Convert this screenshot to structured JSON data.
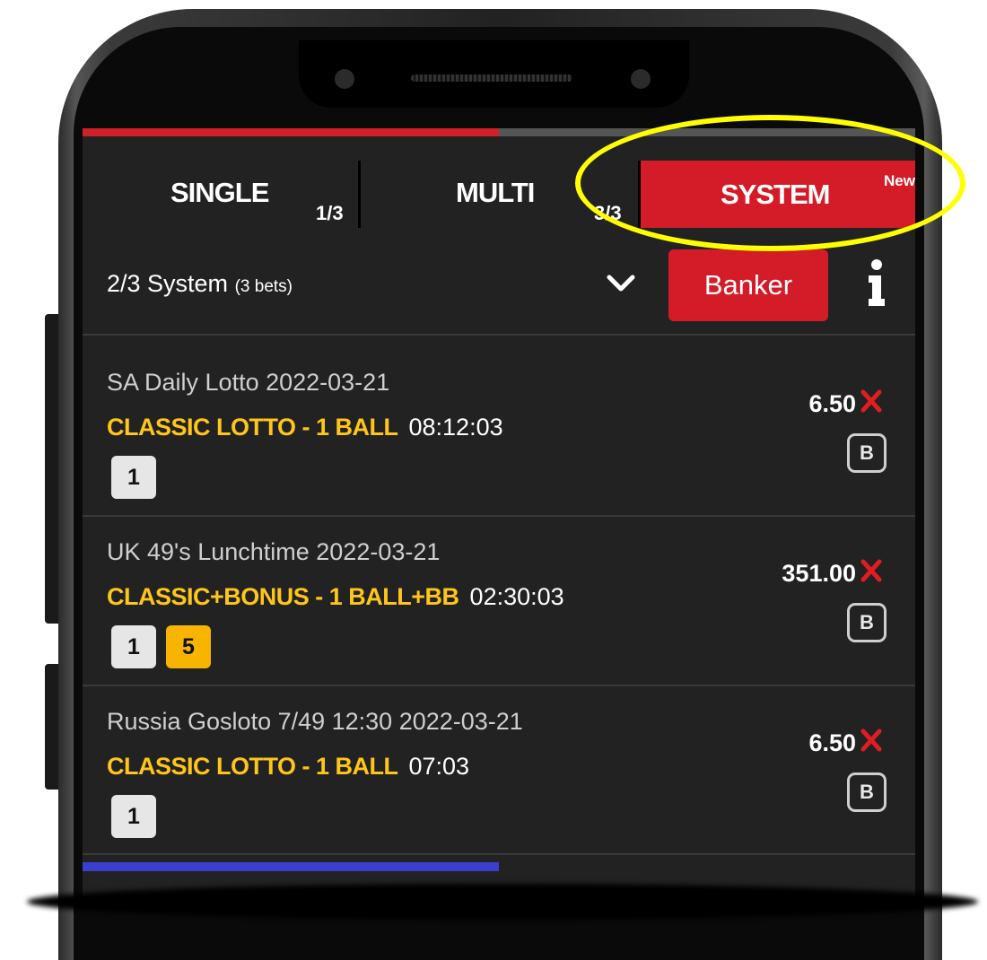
{
  "tabs": {
    "single": {
      "label": "SINGLE",
      "count": "1/3"
    },
    "multi": {
      "label": "MULTI",
      "count": "3/3"
    },
    "system": {
      "label": "SYSTEM",
      "badge": "New"
    }
  },
  "system_bar": {
    "label": "2/3 System",
    "bets_count": "(3 bets)",
    "banker_label": "Banker"
  },
  "progress": {
    "top_fraction": 0.5,
    "bottom_fraction": 0.5
  },
  "bets": [
    {
      "title": "SA Daily Lotto 2022-03-21",
      "market": "CLASSIC LOTTO - 1 BALL",
      "time": "08:12:03",
      "odds": "6.50",
      "balls": [
        "1"
      ],
      "bonus_balls": [],
      "banker_badge": "B"
    },
    {
      "title": "UK 49's Lunchtime 2022-03-21",
      "market": "CLASSIC+BONUS - 1 BALL+BB",
      "time": "02:30:03",
      "odds": "351.00",
      "balls": [
        "1"
      ],
      "bonus_balls": [
        "5"
      ],
      "banker_badge": "B"
    },
    {
      "title": "Russia Gosloto 7/49 12:30 2022-03-21",
      "market": "CLASSIC LOTTO - 1 BALL",
      "time": "07:03",
      "odds": "6.50",
      "balls": [
        "1"
      ],
      "bonus_balls": [],
      "banker_badge": "B"
    }
  ],
  "colors": {
    "accent_red": "#d41c28",
    "market_yellow": "#ffc61a",
    "bonus_ball": "#f7b500",
    "highlight": "#ffff00",
    "screen_bg": "#222222"
  },
  "icons": [
    "chevron-down-icon",
    "info-icon",
    "close-icon"
  ]
}
